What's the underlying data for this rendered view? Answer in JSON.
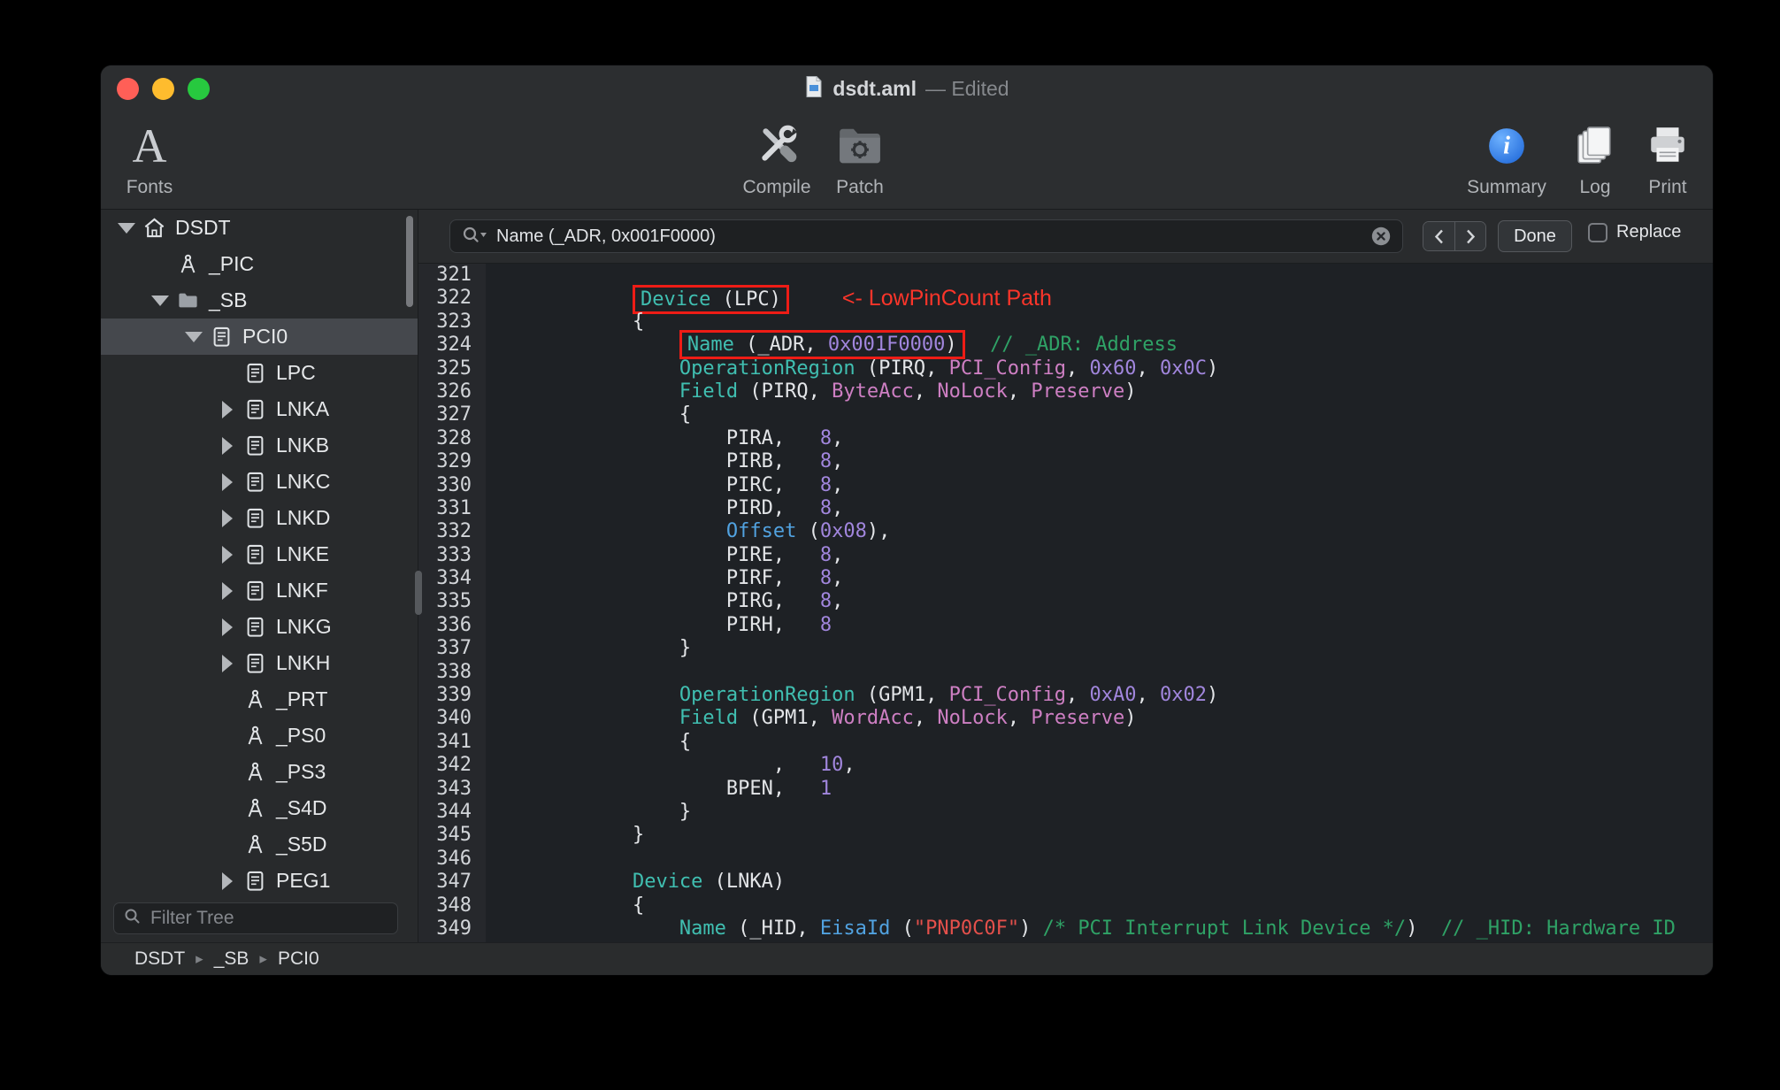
{
  "window": {
    "title": "dsdt.aml",
    "title_suffix": "— Edited",
    "toolbar": {
      "fonts_label": "Fonts",
      "fonts_icon_glyph": "A",
      "compile_label": "Compile",
      "patch_label": "Patch",
      "summary_label": "Summary",
      "log_label": "Log",
      "print_label": "Print"
    }
  },
  "sidebar": {
    "filter_placeholder": "Filter Tree",
    "tree": [
      {
        "label": "DSDT",
        "depth": 0,
        "icon": "home",
        "disclosure": "down",
        "selected": false
      },
      {
        "label": "_PIC",
        "depth": 1,
        "icon": "method",
        "disclosure": "none",
        "selected": false
      },
      {
        "label": "_SB",
        "depth": 1,
        "icon": "folder",
        "disclosure": "down",
        "selected": false
      },
      {
        "label": "PCI0",
        "depth": 2,
        "icon": "device",
        "disclosure": "down",
        "selected": true
      },
      {
        "label": "LPC",
        "depth": 3,
        "icon": "device",
        "disclosure": "none",
        "selected": false
      },
      {
        "label": "LNKA",
        "depth": 3,
        "icon": "device",
        "disclosure": "right",
        "selected": false
      },
      {
        "label": "LNKB",
        "depth": 3,
        "icon": "device",
        "disclosure": "right",
        "selected": false
      },
      {
        "label": "LNKC",
        "depth": 3,
        "icon": "device",
        "disclosure": "right",
        "selected": false
      },
      {
        "label": "LNKD",
        "depth": 3,
        "icon": "device",
        "disclosure": "right",
        "selected": false
      },
      {
        "label": "LNKE",
        "depth": 3,
        "icon": "device",
        "disclosure": "right",
        "selected": false
      },
      {
        "label": "LNKF",
        "depth": 3,
        "icon": "device",
        "disclosure": "right",
        "selected": false
      },
      {
        "label": "LNKG",
        "depth": 3,
        "icon": "device",
        "disclosure": "right",
        "selected": false
      },
      {
        "label": "LNKH",
        "depth": 3,
        "icon": "device",
        "disclosure": "right",
        "selected": false
      },
      {
        "label": "_PRT",
        "depth": 3,
        "icon": "method",
        "disclosure": "none",
        "selected": false
      },
      {
        "label": "_PS0",
        "depth": 3,
        "icon": "method",
        "disclosure": "none",
        "selected": false
      },
      {
        "label": "_PS3",
        "depth": 3,
        "icon": "method",
        "disclosure": "none",
        "selected": false
      },
      {
        "label": "_S4D",
        "depth": 3,
        "icon": "method",
        "disclosure": "none",
        "selected": false
      },
      {
        "label": "_S5D",
        "depth": 3,
        "icon": "method",
        "disclosure": "none",
        "selected": false
      },
      {
        "label": "PEG1",
        "depth": 3,
        "icon": "device",
        "disclosure": "right",
        "selected": false
      }
    ]
  },
  "breadcrumb": {
    "separator": "▸",
    "items": [
      "DSDT",
      "_SB",
      "PCI0"
    ]
  },
  "findbar": {
    "query": "Name (_ADR, 0x001F0000)",
    "done_label": "Done",
    "replace_label": "Replace"
  },
  "editor": {
    "annotation": "<- LowPinCount Path",
    "highlight_color": "#ee1c16",
    "lines": [
      {
        "n": 321,
        "t": []
      },
      {
        "n": 322,
        "t": [
          [
            "            ",
            "p"
          ],
          [
            "Device",
            "k",
            1
          ],
          [
            " (LPC)",
            "p",
            1
          ],
          [
            "<- LowPinCount Path",
            "a"
          ]
        ]
      },
      {
        "n": 323,
        "t": [
          [
            "            {",
            "p"
          ]
        ]
      },
      {
        "n": 324,
        "t": [
          [
            "                ",
            "p"
          ],
          [
            "Name",
            "k",
            1
          ],
          [
            " (_ADR, ",
            "p",
            1
          ],
          [
            "0x001F0000",
            "n",
            1
          ],
          [
            ")",
            "p",
            1
          ],
          [
            "  ",
            "p"
          ],
          [
            "// _ADR: Address",
            "g"
          ]
        ]
      },
      {
        "n": 325,
        "t": [
          [
            "                ",
            "p"
          ],
          [
            "OperationRegion",
            "k"
          ],
          [
            " (PIRQ, ",
            "p"
          ],
          [
            "PCI_Config",
            "c"
          ],
          [
            ", ",
            "p"
          ],
          [
            "0x60",
            "n"
          ],
          [
            ", ",
            "p"
          ],
          [
            "0x0C",
            "n"
          ],
          [
            ")",
            "p"
          ]
        ]
      },
      {
        "n": 326,
        "t": [
          [
            "                ",
            "p"
          ],
          [
            "Field",
            "k"
          ],
          [
            " (PIRQ, ",
            "p"
          ],
          [
            "ByteAcc",
            "c"
          ],
          [
            ", ",
            "p"
          ],
          [
            "NoLock",
            "c"
          ],
          [
            ", ",
            "p"
          ],
          [
            "Preserve",
            "c"
          ],
          [
            ")",
            "p"
          ]
        ]
      },
      {
        "n": 327,
        "t": [
          [
            "                {",
            "p"
          ]
        ]
      },
      {
        "n": 328,
        "t": [
          [
            "                    PIRA,   ",
            "p"
          ],
          [
            "8",
            "n"
          ],
          [
            ",",
            "p"
          ]
        ]
      },
      {
        "n": 329,
        "t": [
          [
            "                    PIRB,   ",
            "p"
          ],
          [
            "8",
            "n"
          ],
          [
            ",",
            "p"
          ]
        ]
      },
      {
        "n": 330,
        "t": [
          [
            "                    PIRC,   ",
            "p"
          ],
          [
            "8",
            "n"
          ],
          [
            ",",
            "p"
          ]
        ]
      },
      {
        "n": 331,
        "t": [
          [
            "                    PIRD,   ",
            "p"
          ],
          [
            "8",
            "n"
          ],
          [
            ",",
            "p"
          ]
        ]
      },
      {
        "n": 332,
        "t": [
          [
            "                    ",
            "p"
          ],
          [
            "Offset",
            "b"
          ],
          [
            " (",
            "p"
          ],
          [
            "0x08",
            "n"
          ],
          [
            "),",
            "p"
          ]
        ]
      },
      {
        "n": 333,
        "t": [
          [
            "                    PIRE,   ",
            "p"
          ],
          [
            "8",
            "n"
          ],
          [
            ",",
            "p"
          ]
        ]
      },
      {
        "n": 334,
        "t": [
          [
            "                    PIRF,   ",
            "p"
          ],
          [
            "8",
            "n"
          ],
          [
            ",",
            "p"
          ]
        ]
      },
      {
        "n": 335,
        "t": [
          [
            "                    PIRG,   ",
            "p"
          ],
          [
            "8",
            "n"
          ],
          [
            ",",
            "p"
          ]
        ]
      },
      {
        "n": 336,
        "t": [
          [
            "                    PIRH,   ",
            "p"
          ],
          [
            "8",
            "n"
          ]
        ]
      },
      {
        "n": 337,
        "t": [
          [
            "                }",
            "p"
          ]
        ]
      },
      {
        "n": 338,
        "t": []
      },
      {
        "n": 339,
        "t": [
          [
            "                ",
            "p"
          ],
          [
            "OperationRegion",
            "k"
          ],
          [
            " (GPM1, ",
            "p"
          ],
          [
            "PCI_Config",
            "c"
          ],
          [
            ", ",
            "p"
          ],
          [
            "0xA0",
            "n"
          ],
          [
            ", ",
            "p"
          ],
          [
            "0x02",
            "n"
          ],
          [
            ")",
            "p"
          ]
        ]
      },
      {
        "n": 340,
        "t": [
          [
            "                ",
            "p"
          ],
          [
            "Field",
            "k"
          ],
          [
            " (GPM1, ",
            "p"
          ],
          [
            "WordAcc",
            "c"
          ],
          [
            ", ",
            "p"
          ],
          [
            "NoLock",
            "c"
          ],
          [
            ", ",
            "p"
          ],
          [
            "Preserve",
            "c"
          ],
          [
            ")",
            "p"
          ]
        ]
      },
      {
        "n": 341,
        "t": [
          [
            "                {",
            "p"
          ]
        ]
      },
      {
        "n": 342,
        "t": [
          [
            "                        ,   ",
            "p"
          ],
          [
            "10",
            "n"
          ],
          [
            ",",
            "p"
          ]
        ]
      },
      {
        "n": 343,
        "t": [
          [
            "                    BPEN,   ",
            "p"
          ],
          [
            "1",
            "n"
          ]
        ]
      },
      {
        "n": 344,
        "t": [
          [
            "                }",
            "p"
          ]
        ]
      },
      {
        "n": 345,
        "t": [
          [
            "            }",
            "p"
          ]
        ]
      },
      {
        "n": 346,
        "t": []
      },
      {
        "n": 347,
        "t": [
          [
            "            ",
            "p"
          ],
          [
            "Device",
            "k"
          ],
          [
            " (LNKA)",
            "p"
          ]
        ]
      },
      {
        "n": 348,
        "t": [
          [
            "            {",
            "p"
          ]
        ]
      },
      {
        "n": 349,
        "t": [
          [
            "                ",
            "p"
          ],
          [
            "Name",
            "k"
          ],
          [
            " (_HID, ",
            "p"
          ],
          [
            "EisaId",
            "b"
          ],
          [
            " (",
            "p"
          ],
          [
            "\"PNP0C0F\"",
            "s"
          ],
          [
            ") ",
            "p"
          ],
          [
            "/* PCI Interrupt Link Device */",
            "g"
          ],
          [
            ")",
            "p"
          ],
          [
            "  ",
            "p"
          ],
          [
            "// _HID: Hardware ID",
            "g"
          ]
        ]
      }
    ]
  }
}
